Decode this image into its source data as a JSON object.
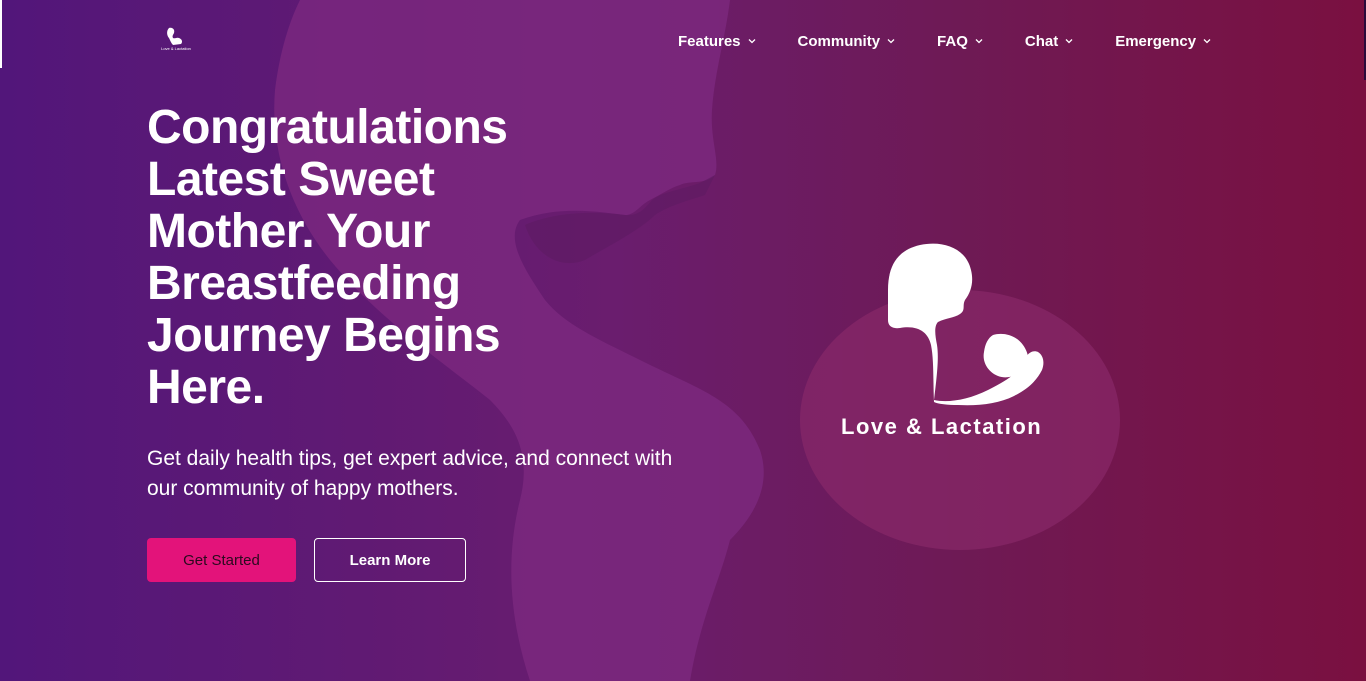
{
  "brand": {
    "name": "Love & Lactation",
    "icon": "mother-baby-logo-icon"
  },
  "nav": {
    "items": [
      {
        "label": "Features",
        "icon": "chevron-down-icon"
      },
      {
        "label": "Community",
        "icon": "chevron-down-icon"
      },
      {
        "label": "FAQ",
        "icon": "chevron-down-icon"
      },
      {
        "label": "Chat",
        "icon": "chevron-down-icon"
      },
      {
        "label": "Emergency",
        "icon": "chevron-down-icon"
      }
    ]
  },
  "hero": {
    "headline": "Congratulations Latest Sweet Mother. Your Breastfeeding Journey Begins Here.",
    "subtext": "Get daily health tips, get expert advice, and connect with our community of happy mothers.",
    "primary_button": "Get Started",
    "secondary_button": "Learn More"
  },
  "logo": {
    "text": "Love & Lactation",
    "icon": "mother-baby-logo-icon"
  },
  "colors": {
    "background_start": "#52167a",
    "background_end": "#7a1040",
    "accent": "#e3137a",
    "text": "#ffffff"
  }
}
